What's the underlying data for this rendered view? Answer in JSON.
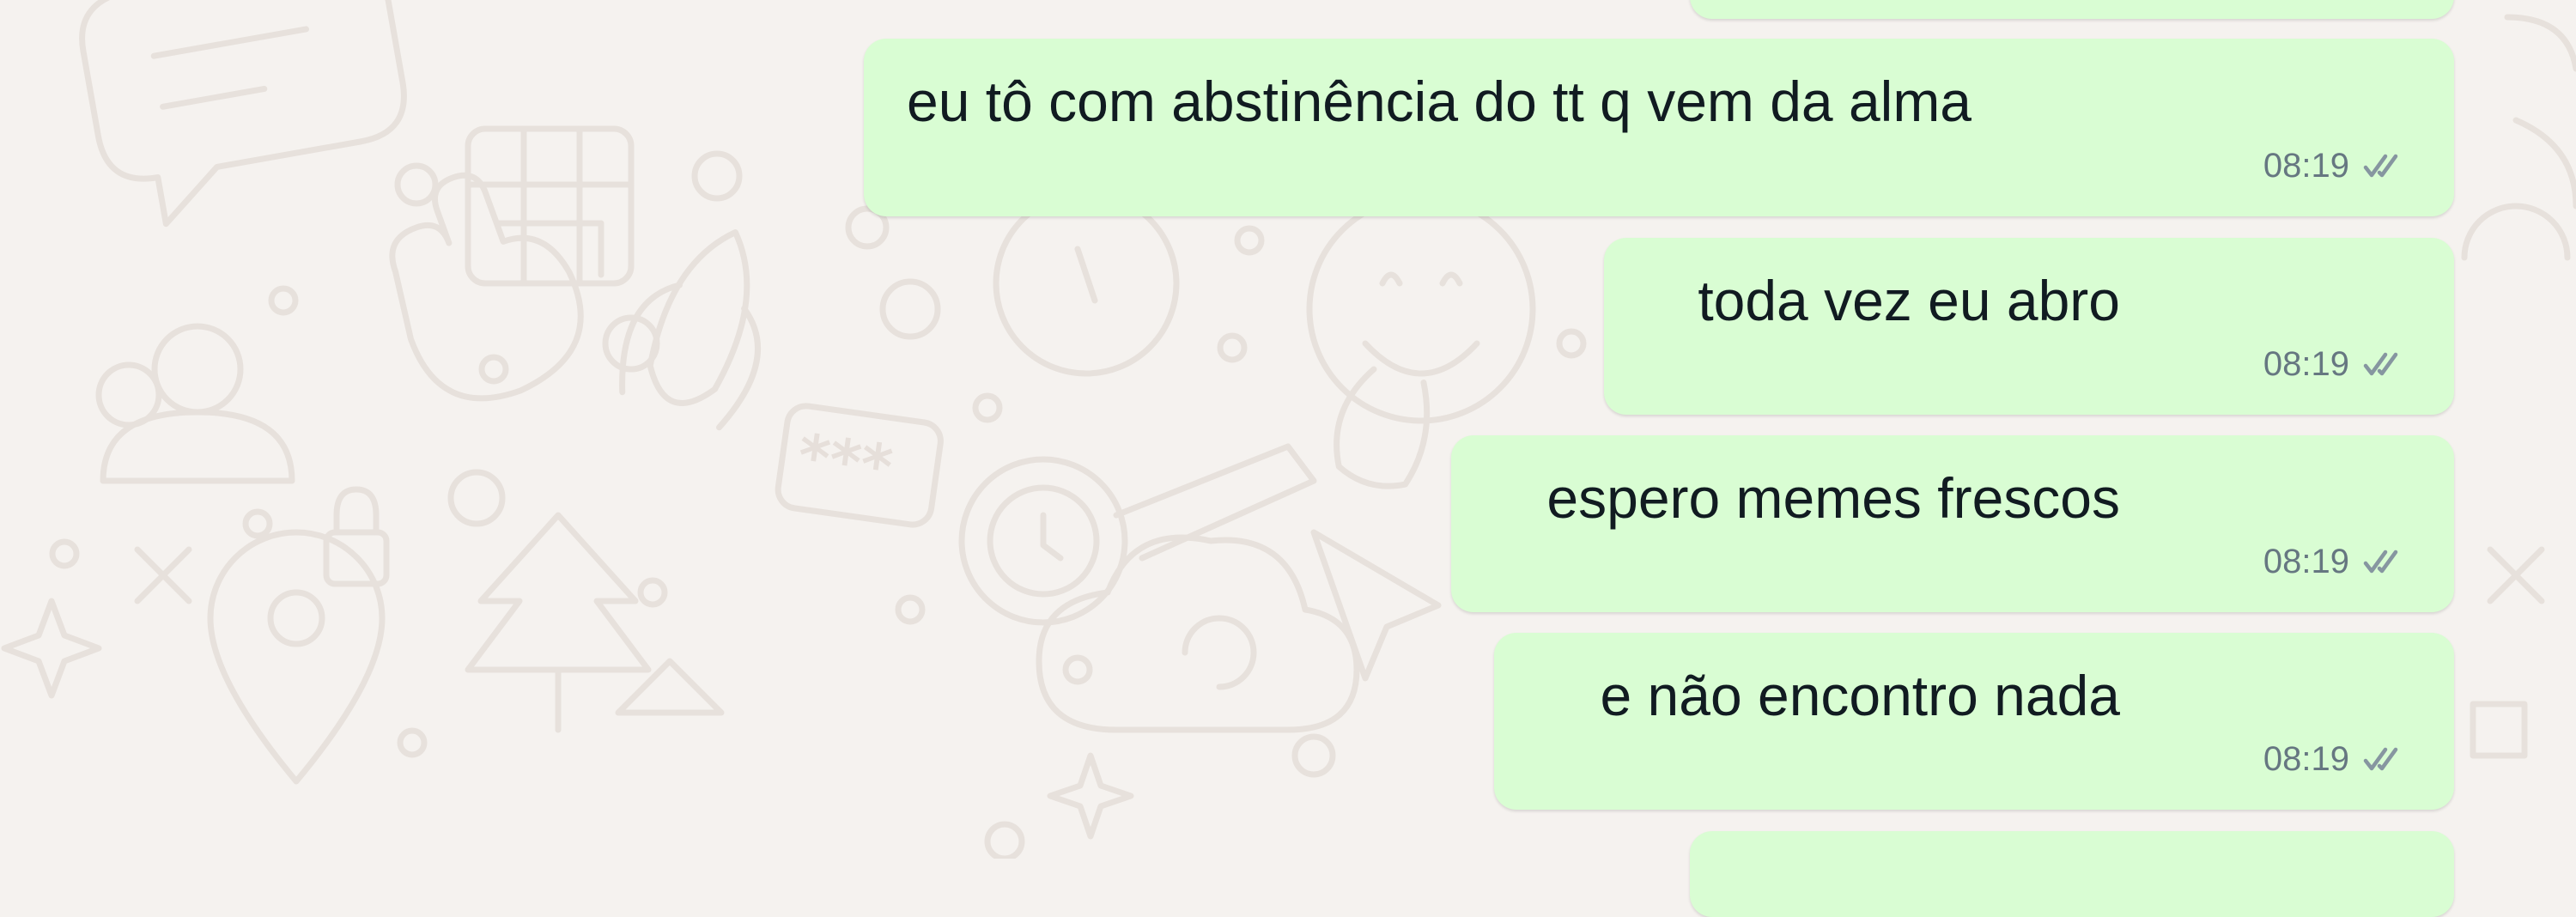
{
  "chat": {
    "messages": [
      {
        "text": "eu tô com abstinência do tt q vem da alma",
        "time": "08:19",
        "status_icon": "double-check-icon"
      },
      {
        "text": "toda vez eu abro",
        "time": "08:19",
        "status_icon": "double-check-icon"
      },
      {
        "text": "espero memes frescos",
        "time": "08:19",
        "status_icon": "double-check-icon"
      },
      {
        "text": "e não encontro nada",
        "time": "08:19",
        "status_icon": "double-check-icon"
      }
    ]
  },
  "theme": {
    "wallpaper_color": "#f5f2ef",
    "outgoing_bubble_color": "#d9fdd3",
    "text_color": "#111b21",
    "meta_color": "#667781"
  }
}
